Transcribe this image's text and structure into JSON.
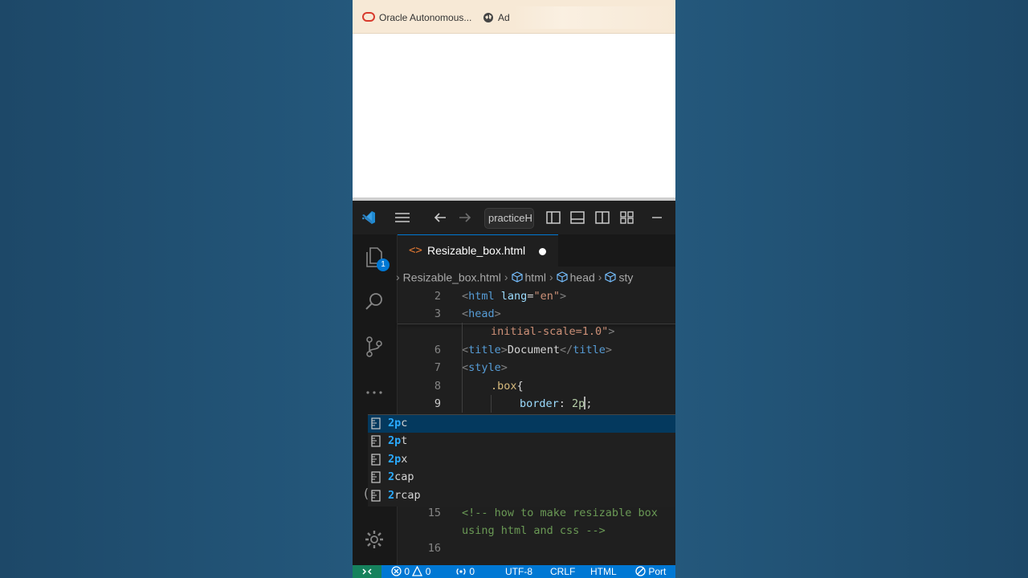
{
  "browser": {
    "bookmarks": [
      {
        "icon": "oracle-icon",
        "label": "Oracle Autonomous..."
      },
      {
        "icon": "globe-icon",
        "label": "Ad"
      }
    ]
  },
  "titlebar": {
    "search_text": "practiceH"
  },
  "activity": {
    "explorer_badge": "1"
  },
  "tab": {
    "icon": "<>",
    "label": "Resizable_box.html",
    "modified": true
  },
  "breadcrumb": {
    "items": [
      "Resizable_box.html",
      "html",
      "head",
      "sty"
    ]
  },
  "code_lines": [
    {
      "num": "2",
      "parts": [
        [
          "tag",
          "<"
        ],
        [
          "tn",
          "html"
        ],
        [
          "txt",
          " "
        ],
        [
          "at",
          "lang"
        ],
        [
          "txt",
          "="
        ],
        [
          "sv",
          "\"en\""
        ],
        [
          "tag",
          ">"
        ]
      ],
      "indent": 0
    },
    {
      "num": "3",
      "parts": [
        [
          "tag",
          "<"
        ],
        [
          "tn",
          "head"
        ],
        [
          "tag",
          ">"
        ]
      ],
      "indent": 0
    },
    {
      "num": "",
      "parts": [
        [
          "sv",
          "initial-scale=1.0\""
        ],
        [
          "tag",
          ">"
        ]
      ],
      "indent": 1
    },
    {
      "num": "6",
      "parts": [
        [
          "tag",
          "<"
        ],
        [
          "tn",
          "title"
        ],
        [
          "tag",
          ">"
        ],
        [
          "txt",
          "Document"
        ],
        [
          "tag",
          "</"
        ],
        [
          "tn",
          "title"
        ],
        [
          "tag",
          ">"
        ]
      ],
      "indent": 0
    },
    {
      "num": "7",
      "parts": [
        [
          "tag",
          "<"
        ],
        [
          "tn",
          "style"
        ],
        [
          "tag",
          ">"
        ]
      ],
      "indent": 0
    },
    {
      "num": "8",
      "parts": [
        [
          "sel",
          ".box"
        ],
        [
          "txt",
          "{"
        ]
      ],
      "indent": 1
    },
    {
      "num": "9",
      "parts": [
        [
          "prop",
          "border"
        ],
        [
          "txt",
          ": "
        ],
        [
          "num",
          "2p"
        ],
        [
          "cursor",
          ""
        ],
        [
          "txt",
          ";"
        ]
      ],
      "indent": 2,
      "active": true
    }
  ],
  "suggestions": [
    {
      "match": "2p",
      "rest": "c",
      "selected": true
    },
    {
      "match": "2p",
      "rest": "t",
      "selected": false
    },
    {
      "match": "2p",
      "rest": "x",
      "selected": false
    },
    {
      "match": "2",
      "rest": "cap",
      "selected": false
    },
    {
      "match": "2",
      "rest": "rcap",
      "selected": false
    }
  ],
  "code_lines_after": [
    {
      "num": "15",
      "text": "<!-- how to make resizable box"
    },
    {
      "num": "",
      "text": "using html and css -->"
    },
    {
      "num": "16",
      "text": ""
    }
  ],
  "statusbar": {
    "errors": "0",
    "warnings": "0",
    "ports": "0",
    "encoding": "UTF-8",
    "eol": "CRLF",
    "language": "HTML",
    "port_label": "Port"
  },
  "colors": {
    "accent": "#0078d4",
    "remote": "#16825d",
    "suggest_selected": "#04395e"
  }
}
